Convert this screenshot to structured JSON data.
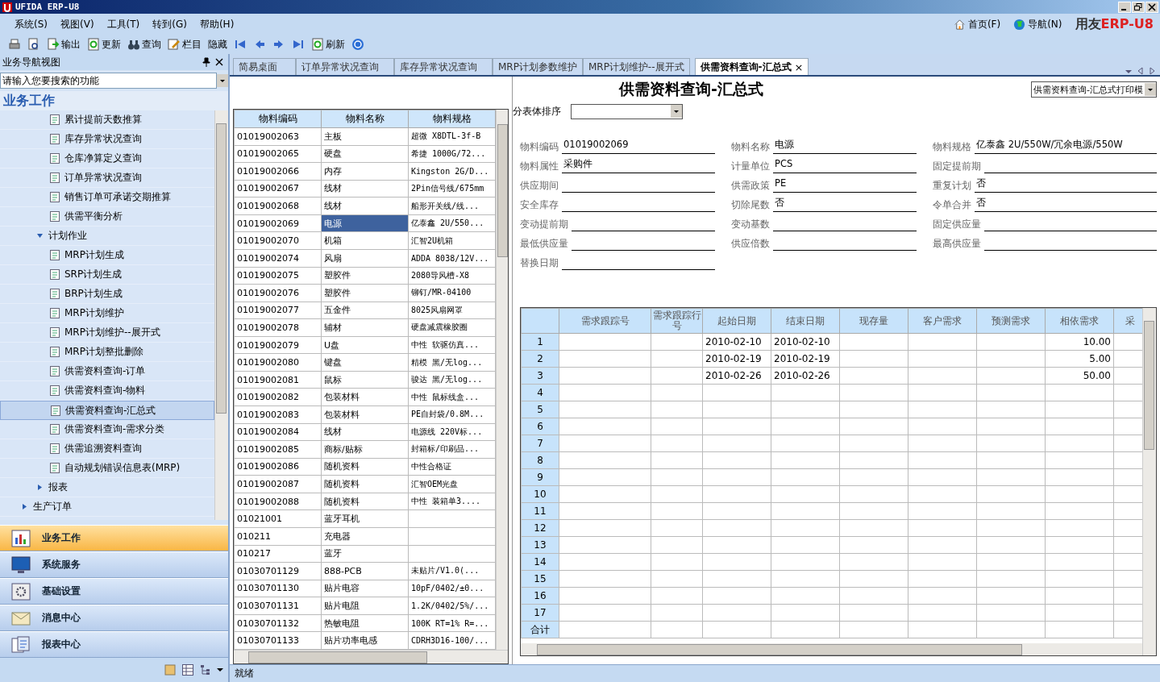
{
  "window": {
    "title": "UFIDA ERP-U8"
  },
  "menu": [
    "系统(S)",
    "视图(V)",
    "工具(T)",
    "转到(G)",
    "帮助(H)"
  ],
  "top_links": [
    "首页(F)",
    "导航(N)"
  ],
  "logo": {
    "brand": "用友",
    "product": "ERP-U8"
  },
  "toolbar": {
    "group_1": [
      "输出",
      "更新",
      "查询",
      "栏目",
      "隐藏"
    ],
    "group_2": [
      "刷新"
    ]
  },
  "nav": {
    "title": "业务导航视图",
    "search": {
      "placeholder": "请输入您要搜索的功能"
    },
    "heading": "业务工作",
    "tree": [
      {
        "kind": "continued",
        "children": [
          {
            "kind": "continued",
            "children": [
              {
                "kind": "leaf",
                "label": "累计提前天数推算",
                "selected": false
              },
              {
                "kind": "leaf",
                "label": "库存异常状况查询",
                "selected": false
              },
              {
                "kind": "leaf",
                "label": "仓库净算定义查询",
                "selected": false
              },
              {
                "kind": "leaf",
                "label": "订单异常状况查询",
                "selected": false
              },
              {
                "kind": "leaf",
                "label": "销售订单可承诺交期推算",
                "selected": false
              },
              {
                "kind": "leaf",
                "label": "供需平衡分析",
                "selected": false
              }
            ]
          },
          {
            "kind": "folder",
            "label": "计划作业",
            "expanded": true,
            "children": [
              {
                "kind": "leaf",
                "label": "MRP计划生成",
                "selected": false
              },
              {
                "kind": "leaf",
                "label": "SRP计划生成",
                "selected": false
              },
              {
                "kind": "leaf",
                "label": "BRP计划生成",
                "selected": false
              },
              {
                "kind": "leaf",
                "label": "MRP计划维护",
                "selected": false
              },
              {
                "kind": "leaf",
                "label": "MRP计划维护--展开式",
                "selected": false
              },
              {
                "kind": "leaf",
                "label": "MRP计划整批删除",
                "selected": false
              },
              {
                "kind": "leaf",
                "label": "供需资料查询-订单",
                "selected": false
              },
              {
                "kind": "leaf",
                "label": "供需资料查询-物料",
                "selected": false
              },
              {
                "kind": "leaf",
                "label": "供需资料查询-汇总式",
                "selected": true
              },
              {
                "kind": "leaf",
                "label": "供需资料查询-需求分类",
                "selected": false
              },
              {
                "kind": "leaf",
                "label": "供需追溯资料查询",
                "selected": false
              },
              {
                "kind": "leaf",
                "label": "自动规划错误信息表(MRP)",
                "selected": false
              }
            ]
          },
          {
            "kind": "folder",
            "label": "报表",
            "expanded": false
          }
        ]
      },
      {
        "kind": "folder",
        "label": "生产订单",
        "expanded": false
      }
    ],
    "sections": [
      {
        "label": "业务工作",
        "selected": true
      },
      {
        "label": "系统服务",
        "selected": false
      },
      {
        "label": "基础设置",
        "selected": false
      },
      {
        "label": "消息中心",
        "selected": false
      },
      {
        "label": "报表中心",
        "selected": false
      }
    ]
  },
  "tabs": [
    {
      "label": "简易桌面",
      "selected": false
    },
    {
      "label": "订单异常状况查询",
      "selected": false
    },
    {
      "label": "库存异常状况查询",
      "selected": false
    },
    {
      "label": "MRP计划参数维护",
      "selected": false
    },
    {
      "label": "MRP计划维护--展开式",
      "selected": false
    },
    {
      "label": "供需资料查询-汇总式",
      "selected": true,
      "close": "×"
    }
  ],
  "materials": {
    "columns": [
      "物料编码",
      "物料名称",
      "物料规格"
    ],
    "rows": [
      {
        "code": "01019002063",
        "name": "主板",
        "spec": "超微 X8DTL-3f-B",
        "selected": false
      },
      {
        "code": "01019002065",
        "name": "硬盘",
        "spec": "希捷 1000G/72...",
        "selected": false
      },
      {
        "code": "01019002066",
        "name": "内存",
        "spec": "Kingston 2G/D...",
        "selected": false
      },
      {
        "code": "01019002067",
        "name": "线材",
        "spec": "2Pin信号线/675mm",
        "selected": false
      },
      {
        "code": "01019002068",
        "name": "线材",
        "spec": "船形开关线/线...",
        "selected": false
      },
      {
        "code": "01019002069",
        "name": "电源",
        "spec": "亿泰鑫 2U/550...",
        "selected": true
      },
      {
        "code": "01019002070",
        "name": "机箱",
        "spec": "汇智2U机箱",
        "selected": false
      },
      {
        "code": "01019002074",
        "name": "风扇",
        "spec": "ADDA 8038/12V...",
        "selected": false
      },
      {
        "code": "01019002075",
        "name": "塑胶件",
        "spec": "2080导风槽-X8",
        "selected": false
      },
      {
        "code": "01019002076",
        "name": "塑胶件",
        "spec": "铆钉/MR-04100",
        "selected": false
      },
      {
        "code": "01019002077",
        "name": "五金件",
        "spec": "8025风扇网罩",
        "selected": false
      },
      {
        "code": "01019002078",
        "name": "辅材",
        "spec": "硬盘减震橡胶圈",
        "selected": false
      },
      {
        "code": "01019002079",
        "name": "U盘",
        "spec": "中性 软驱仿真...",
        "selected": false
      },
      {
        "code": "01019002080",
        "name": "键盘",
        "spec": "精模 黑/无log...",
        "selected": false
      },
      {
        "code": "01019002081",
        "name": "鼠标",
        "spec": "骏达 黑/无log...",
        "selected": false
      },
      {
        "code": "01019002082",
        "name": "包装材料",
        "spec": "中性 鼠标线盒...",
        "selected": false
      },
      {
        "code": "01019002083",
        "name": "包装材料",
        "spec": "PE自封袋/0.8M...",
        "selected": false
      },
      {
        "code": "01019002084",
        "name": "线材",
        "spec": "电源线 220V标...",
        "selected": false
      },
      {
        "code": "01019002085",
        "name": "商标/贴标",
        "spec": "封箱标/印刷品...",
        "selected": false
      },
      {
        "code": "01019002086",
        "name": "随机资料",
        "spec": "中性合格证",
        "selected": false
      },
      {
        "code": "01019002087",
        "name": "随机资料",
        "spec": "汇智OEM光盘",
        "selected": false
      },
      {
        "code": "01019002088",
        "name": "随机资料",
        "spec": "中性 装箱单3....",
        "selected": false
      },
      {
        "code": "01021001",
        "name": "蓝牙耳机",
        "selected": false
      },
      {
        "code": "010211",
        "name": "充电器",
        "selected": false
      },
      {
        "code": "010217",
        "name": "蓝牙",
        "selected": false
      },
      {
        "code": "01030701129",
        "name": "888-PCB",
        "spec": "未贴片/V1.0(...",
        "selected": false
      },
      {
        "code": "01030701130",
        "name": "贴片电容",
        "spec": "10pF/0402/±0...",
        "selected": false
      },
      {
        "code": "01030701131",
        "name": "贴片电阻",
        "spec": "1.2K/0402/5%/...",
        "selected": false
      },
      {
        "code": "01030701132",
        "name": "热敏电阻",
        "spec": "100K RT=1% R=...",
        "selected": false
      },
      {
        "code": "01030701133",
        "name": "贴片功率电感",
        "spec": "CDRH3D16-100/...",
        "selected": false
      }
    ]
  },
  "form": {
    "title": "供需资料查询-汇总式",
    "template": "供需资料查询-汇总式打印模",
    "sort_label": "分表体排序",
    "fields": [
      {
        "label": "物料编码",
        "value": "01019002069"
      },
      {
        "label": "物料名称",
        "value": "电源"
      },
      {
        "label": "物料规格",
        "value": "亿泰鑫 2U/550W/冗余电源/550W"
      },
      {
        "label": "物料属性",
        "value": "采购件"
      },
      {
        "label": "计量单位",
        "value": "PCS"
      },
      {
        "label": "固定提前期"
      },
      {
        "label": "供应期间"
      },
      {
        "label": "供需政策",
        "value": "PE"
      },
      {
        "label": "重复计划",
        "value": "否"
      },
      {
        "label": "安全库存"
      },
      {
        "label": "切除尾数",
        "value": "否"
      },
      {
        "label": "令单合并",
        "value": "否"
      },
      {
        "label": "变动提前期"
      },
      {
        "label": "变动基数"
      },
      {
        "label": "固定供应量"
      },
      {
        "label": "最低供应量"
      },
      {
        "label": "供应倍数"
      },
      {
        "label": "最高供应量"
      },
      {
        "label": "替换日期"
      }
    ],
    "grid": {
      "columns": [
        "需求跟踪号",
        "需求跟踪行号",
        "起始日期",
        "结束日期",
        "现存量",
        "客户需求",
        "预测需求",
        "相依需求",
        "采"
      ],
      "rows": [
        {
          "number": "1",
          "start": "2010-02-10",
          "end": "2010-02-10",
          "dependent": "10.00"
        },
        {
          "number": "2",
          "start": "2010-02-19",
          "end": "2010-02-19",
          "dependent": "5.00"
        },
        {
          "number": "3",
          "start": "2010-02-26",
          "end": "2010-02-26",
          "dependent": "50.00"
        },
        {
          "number": "4"
        },
        {
          "number": "5"
        },
        {
          "number": "6"
        },
        {
          "number": "7"
        },
        {
          "number": "8"
        },
        {
          "number": "9"
        },
        {
          "number": "10"
        },
        {
          "number": "11"
        },
        {
          "number": "12"
        },
        {
          "number": "13"
        },
        {
          "number": "14"
        },
        {
          "number": "15"
        },
        {
          "number": "16"
        },
        {
          "number": "17"
        }
      ],
      "footer": "合计"
    }
  },
  "status": "就绪"
}
